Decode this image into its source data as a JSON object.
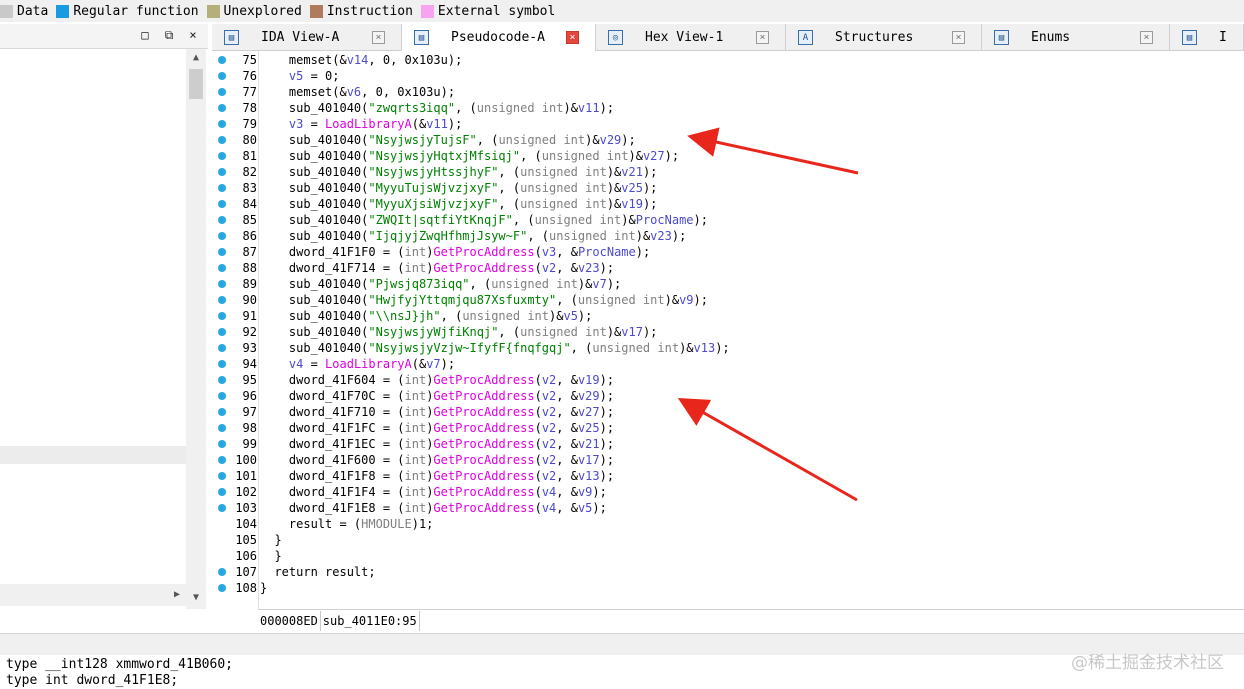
{
  "legend": [
    {
      "label": "Data",
      "color": "#c9c9c9"
    },
    {
      "label": "Regular function",
      "color": "#1a9be0"
    },
    {
      "label": "Unexplored",
      "color": "#b3b07a"
    },
    {
      "label": "Instruction",
      "color": "#b07a5c"
    },
    {
      "label": "External symbol",
      "color": "#f7a4f0"
    }
  ],
  "left_pane": {
    "restore_symbol": "□",
    "float_symbol": "⧉",
    "close_symbol": "×"
  },
  "tabs": [
    {
      "label": "IDA View-A",
      "icon": "ida-view-icon",
      "active": false
    },
    {
      "label": "Pseudocode-A",
      "icon": "pseudocode-icon",
      "active": true
    },
    {
      "label": "Hex View-1",
      "icon": "hex-view-icon",
      "active": false
    },
    {
      "label": "Structures",
      "icon": "structures-icon",
      "active": false
    },
    {
      "label": "Enums",
      "icon": "enums-icon",
      "active": false
    },
    {
      "label": "I",
      "icon": "imports-icon",
      "active": false
    }
  ],
  "code": {
    "line_numbers": [
      "75",
      "76",
      "77",
      "78",
      "79",
      "80",
      "81",
      "82",
      "83",
      "84",
      "85",
      "86",
      "87",
      "88",
      "89",
      "90",
      "91",
      "92",
      "93",
      "94",
      "95",
      "96",
      "97",
      "98",
      "99",
      "100",
      "101",
      "102",
      "103",
      "104",
      "105",
      "106",
      "107",
      "108"
    ],
    "lines": [
      "    memset(&v14, 0, 0x103u);",
      "    v5 = 0;",
      "    memset(&v6, 0, 0x103u);",
      "    sub_401040(\"zwqrts3iqq\", (unsigned int)&v11);",
      "    v3 = LoadLibraryA(&v11);",
      "    sub_401040(\"NsyjwsjyTujsF\", (unsigned int)&v29);",
      "    sub_401040(\"NsyjwsjyHqtxjMfsiqj\", (unsigned int)&v27);",
      "    sub_401040(\"NsyjwsjyHtssjhyF\", (unsigned int)&v21);",
      "    sub_401040(\"MyyuTujsWjvzjxyF\", (unsigned int)&v25);",
      "    sub_401040(\"MyyuXjsiWjvzjxyF\", (unsigned int)&v19);",
      "    sub_401040(\"ZWQIt|sqtfiYtKnqjF\", (unsigned int)&ProcName);",
      "    sub_401040(\"IjqjyjZwqHfhmjJsyw~F\", (unsigned int)&v23);",
      "    dword_41F1F0 = (int)GetProcAddress(v3, &ProcName);",
      "    dword_41F714 = (int)GetProcAddress(v2, &v23);",
      "    sub_401040(\"Pjwsjq873iqq\", (unsigned int)&v7);",
      "    sub_401040(\"HwjfyjYttqmjqu87Xsfuxmty\", (unsigned int)&v9);",
      "    sub_401040(\"\\\\nsJ}jh\", (unsigned int)&v5);",
      "    sub_401040(\"NsyjwsjyWjfiKnqj\", (unsigned int)&v17);",
      "    sub_401040(\"NsyjwsjyVzjw~IfyfF{fnqfgqj\", (unsigned int)&v13);",
      "    v4 = LoadLibraryA(&v7);",
      "    dword_41F604 = (int)GetProcAddress(v2, &v19);",
      "    dword_41F70C = (int)GetProcAddress(v2, &v29);",
      "    dword_41F710 = (int)GetProcAddress(v2, &v27);",
      "    dword_41F1FC = (int)GetProcAddress(v2, &v25);",
      "    dword_41F1EC = (int)GetProcAddress(v2, &v21);",
      "    dword_41F600 = (int)GetProcAddress(v2, &v17);",
      "    dword_41F1F8 = (int)GetProcAddress(v2, &v13);",
      "    dword_41F1F4 = (int)GetProcAddress(v4, &v9);",
      "    dword_41F1E8 = (int)GetProcAddress(v4, &v5);",
      "    result = (HMODULE)1;",
      "  }",
      "}",
      "return result;",
      "}"
    ],
    "dotted_lines": [
      "75",
      "76",
      "77",
      "78",
      "79",
      "80",
      "81",
      "82",
      "83",
      "84",
      "85",
      "86",
      "87",
      "88",
      "89",
      "90",
      "91",
      "92",
      "93",
      "94",
      "95",
      "96",
      "97",
      "98",
      "99",
      "100",
      "101",
      "102",
      "103",
      "107",
      "108"
    ]
  },
  "status": {
    "address": "000008ED",
    "location": "sub_4011E0:95"
  },
  "output": {
    "lines": [
      "type __int128 xmmword_41B060;",
      "type int dword_41F1E8;"
    ]
  },
  "watermark": "@稀土掘金技术社区",
  "colors": {
    "string": "#008000",
    "api": "#e000e0",
    "variable": "#4a4acc",
    "annotation_arrow": "#e8261c"
  }
}
